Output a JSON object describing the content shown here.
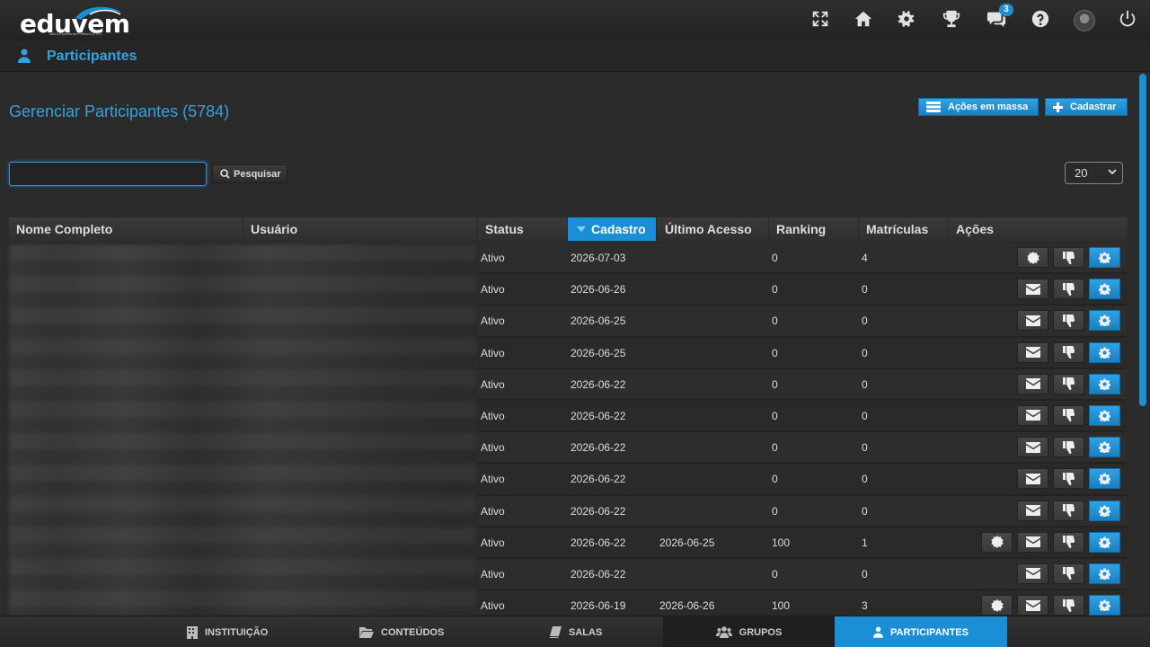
{
  "brand": {
    "name": "eduvem",
    "tagline": "Talent Experience Platform (TXP)"
  },
  "header": {
    "icons": [
      "fullscreen-icon",
      "home-icon",
      "settings-icon",
      "trophy-icon",
      "chat-icon",
      "help-icon",
      "avatar",
      "power-icon"
    ],
    "chat_badge": "3"
  },
  "section": {
    "title": "Participantes"
  },
  "main": {
    "heading": "Gerenciar Participantes (5784)",
    "bulk_actions_label": "Ações em massa",
    "register_label": "Cadastrar",
    "search": {
      "value": "",
      "placeholder": "",
      "button_label": "Pesquisar"
    },
    "page_size": "20"
  },
  "table": {
    "columns": [
      "Nome Completo",
      "Usuário",
      "Status",
      "Cadastro",
      "Último Acesso",
      "Ranking",
      "Matrículas",
      "Ações"
    ],
    "sorted_column": "Cadastro",
    "rows": [
      {
        "status": "Ativo",
        "cadastro": "2026-07-03",
        "ultimo_acesso": "",
        "ranking": "0",
        "matriculas": "4",
        "actions": [
          "badge",
          "dislike",
          "settings"
        ]
      },
      {
        "status": "Ativo",
        "cadastro": "2026-06-26",
        "ultimo_acesso": "",
        "ranking": "0",
        "matriculas": "0",
        "actions": [
          "mail",
          "dislike",
          "settings"
        ]
      },
      {
        "status": "Ativo",
        "cadastro": "2026-06-25",
        "ultimo_acesso": "",
        "ranking": "0",
        "matriculas": "0",
        "actions": [
          "mail",
          "dislike",
          "settings"
        ]
      },
      {
        "status": "Ativo",
        "cadastro": "2026-06-25",
        "ultimo_acesso": "",
        "ranking": "0",
        "matriculas": "0",
        "actions": [
          "mail",
          "dislike",
          "settings"
        ]
      },
      {
        "status": "Ativo",
        "cadastro": "2026-06-22",
        "ultimo_acesso": "",
        "ranking": "0",
        "matriculas": "0",
        "actions": [
          "mail",
          "dislike",
          "settings"
        ]
      },
      {
        "status": "Ativo",
        "cadastro": "2026-06-22",
        "ultimo_acesso": "",
        "ranking": "0",
        "matriculas": "0",
        "actions": [
          "mail",
          "dislike",
          "settings"
        ]
      },
      {
        "status": "Ativo",
        "cadastro": "2026-06-22",
        "ultimo_acesso": "",
        "ranking": "0",
        "matriculas": "0",
        "actions": [
          "mail",
          "dislike",
          "settings"
        ]
      },
      {
        "status": "Ativo",
        "cadastro": "2026-06-22",
        "ultimo_acesso": "",
        "ranking": "0",
        "matriculas": "0",
        "actions": [
          "mail",
          "dislike",
          "settings"
        ]
      },
      {
        "status": "Ativo",
        "cadastro": "2026-06-22",
        "ultimo_acesso": "",
        "ranking": "0",
        "matriculas": "0",
        "actions": [
          "mail",
          "dislike",
          "settings"
        ]
      },
      {
        "status": "Ativo",
        "cadastro": "2026-06-22",
        "ultimo_acesso": "2026-06-25",
        "ranking": "100",
        "matriculas": "1",
        "actions": [
          "badge",
          "mail",
          "dislike",
          "settings"
        ]
      },
      {
        "status": "Ativo",
        "cadastro": "2026-06-22",
        "ultimo_acesso": "",
        "ranking": "0",
        "matriculas": "0",
        "actions": [
          "mail",
          "dislike",
          "settings"
        ]
      },
      {
        "status": "Ativo",
        "cadastro": "2026-06-19",
        "ultimo_acesso": "2026-06-26",
        "ranking": "100",
        "matriculas": "3",
        "actions": [
          "badge",
          "mail",
          "dislike",
          "settings"
        ]
      }
    ]
  },
  "bottom_nav": [
    {
      "label": "INSTITUIÇÃO",
      "icon": "building-icon"
    },
    {
      "label": "CONTEÚDOS",
      "icon": "folder-icon"
    },
    {
      "label": "SALAS",
      "icon": "book-icon"
    },
    {
      "label": "GRUPOS",
      "icon": "group-icon"
    },
    {
      "label": "PARTICIPANTES",
      "icon": "user-icon",
      "active": true
    }
  ],
  "colors": {
    "accent": "#1a8fd6",
    "accent_text": "#34a2e0",
    "background": "#2b2b2b"
  }
}
